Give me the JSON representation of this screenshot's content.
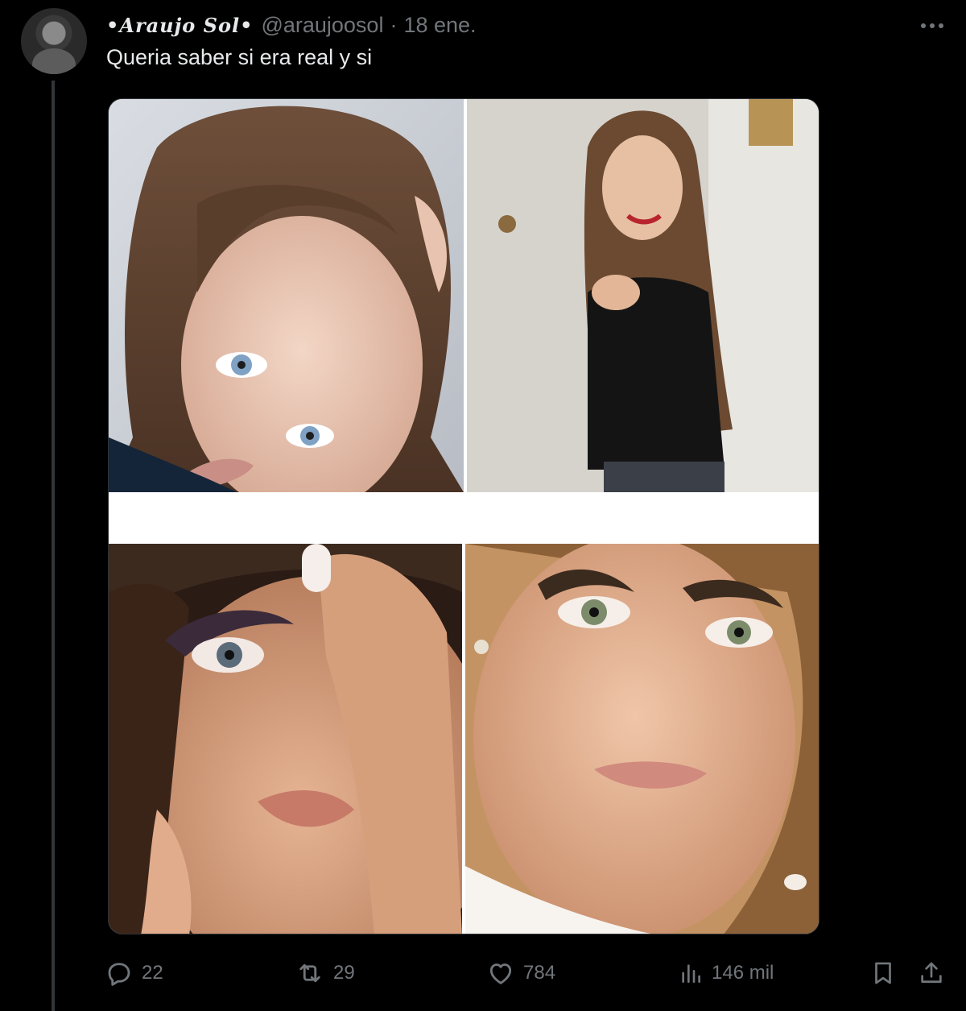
{
  "tweet": {
    "display_name": "•Araujo Sol•",
    "handle": "@araujoosol",
    "separator": "·",
    "date": "18 ene.",
    "text": "Queria saber si era real y si"
  },
  "actions": {
    "replies": "22",
    "retweets": "29",
    "likes": "784",
    "views": "146 mil"
  },
  "icons": {
    "more": "more-horizontal-icon",
    "reply": "reply-icon",
    "retweet": "retweet-icon",
    "like": "heart-icon",
    "views": "views-chart-icon",
    "bookmark": "bookmark-icon",
    "share": "share-icon"
  },
  "colors": {
    "background": "#000000",
    "text_primary": "#e7e9ea",
    "text_secondary": "#71767b",
    "thread_line": "#333639"
  }
}
